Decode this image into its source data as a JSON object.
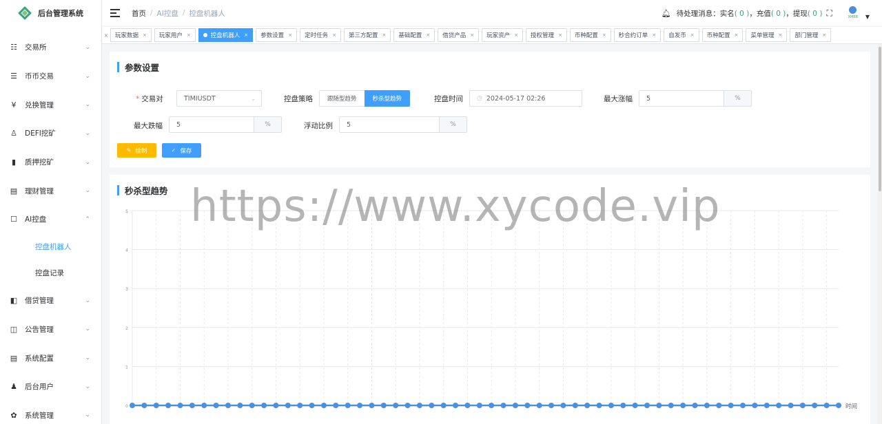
{
  "app": {
    "title": "后台管理系统"
  },
  "sidebar": {
    "items": [
      {
        "label": "交易所",
        "icon": "list-icon",
        "glyph": "☷",
        "arrow": "⌄"
      },
      {
        "label": "币币交易",
        "icon": "list-icon",
        "glyph": "☰",
        "arrow": "⌄"
      },
      {
        "label": "兑换管理",
        "icon": "yen-icon",
        "glyph": "¥",
        "arrow": "⌄"
      },
      {
        "label": "DEFI挖矿",
        "icon": "user-icon",
        "glyph": "♙",
        "arrow": "⌄"
      },
      {
        "label": "质押挖矿",
        "icon": "bar-chart-icon",
        "glyph": "▮",
        "arrow": "⌄"
      },
      {
        "label": "理财管理",
        "icon": "document-icon",
        "glyph": "▤",
        "arrow": "⌄"
      },
      {
        "label": "AI控盘",
        "icon": "robot-icon",
        "glyph": "☐",
        "arrow": "⌃",
        "expanded": true,
        "children": [
          {
            "label": "控盘机器人",
            "active": true
          },
          {
            "label": "控盘记录"
          }
        ]
      },
      {
        "label": "借贷管理",
        "icon": "book-icon",
        "glyph": "◧",
        "arrow": "⌄"
      },
      {
        "label": "公告管理",
        "icon": "open-book-icon",
        "glyph": "◫",
        "arrow": "⌄"
      },
      {
        "label": "系统配置",
        "icon": "form-icon",
        "glyph": "▤",
        "arrow": "⌄"
      },
      {
        "label": "后台用户",
        "icon": "users-icon",
        "glyph": "♟",
        "arrow": "⌄"
      },
      {
        "label": "系统管理",
        "icon": "gear-icon",
        "glyph": "✿",
        "arrow": "⌄"
      }
    ]
  },
  "header": {
    "breadcrumb": [
      "首页",
      "AI控盘",
      "控盘机器人"
    ],
    "pending_label": "待处理消息：",
    "pending": [
      {
        "label": "实名",
        "count": "( 0 )"
      },
      {
        "label": "充值",
        "count": "( 0 )"
      },
      {
        "label": "提现",
        "count": "( 0 )"
      }
    ],
    "sep": "，",
    "avatar_text": "XMEB"
  },
  "tags": [
    {
      "label": "玩家数据",
      "close": "×"
    },
    {
      "label": "玩家用户",
      "close": "×"
    },
    {
      "label": "控盘机器人",
      "close": "×",
      "active": true
    },
    {
      "label": "参数设置",
      "close": "×"
    },
    {
      "label": "定时任务",
      "close": "×"
    },
    {
      "label": "第三方配置",
      "close": "×"
    },
    {
      "label": "基础配置",
      "close": "×"
    },
    {
      "label": "借贷产品",
      "close": "×"
    },
    {
      "label": "玩家资产",
      "close": "×"
    },
    {
      "label": "授权管理",
      "close": "×"
    },
    {
      "label": "币种配置",
      "close": "×"
    },
    {
      "label": "秒合约订单",
      "close": "×"
    },
    {
      "label": "自发币",
      "close": "×"
    },
    {
      "label": "币种配置",
      "close": "×"
    },
    {
      "label": "菜单管理",
      "close": "×"
    },
    {
      "label": "部门管理",
      "close": "×"
    }
  ],
  "params": {
    "title": "参数设置",
    "pair_label": "交易对",
    "pair_value": "TIMIUSDT",
    "strategy_label": "控盘策略",
    "strategy_options": [
      "跟随型趋势",
      "秒杀型趋势"
    ],
    "strategy_selected": "秒杀型趋势",
    "time_label": "控盘时间",
    "time_value": "2024-05-17 02:26",
    "max_up_label": "最大涨幅",
    "max_up_value": "5",
    "max_down_label": "最大跌幅",
    "max_down_value": "5",
    "float_label": "浮动比例",
    "float_value": "5",
    "unit": "%",
    "draw_label": "绘制",
    "save_label": "保存"
  },
  "chart_section": {
    "title": "秒杀型趋势"
  },
  "chart_data": {
    "type": "line",
    "title": "",
    "xlabel": "时间",
    "ylabel": "",
    "ylim": [
      0,
      5
    ],
    "yticks": [
      "0",
      "1",
      "2",
      "3",
      "4",
      "5"
    ],
    "grid": true,
    "point_count": 60,
    "series": [
      {
        "values": [
          0,
          0,
          0,
          0,
          0,
          0,
          0,
          0,
          0,
          0,
          0,
          0,
          0,
          0,
          0,
          0,
          0,
          0,
          0,
          0,
          0,
          0,
          0,
          0,
          0,
          0,
          0,
          0,
          0,
          0,
          0,
          0,
          0,
          0,
          0,
          0,
          0,
          0,
          0,
          0,
          0,
          0,
          0,
          0,
          0,
          0,
          0,
          0,
          0,
          0,
          0,
          0,
          0,
          0,
          0,
          0,
          0,
          0,
          0,
          0
        ],
        "color": "#4a90e2"
      }
    ]
  },
  "watermark": "https://www.xycode.vip"
}
